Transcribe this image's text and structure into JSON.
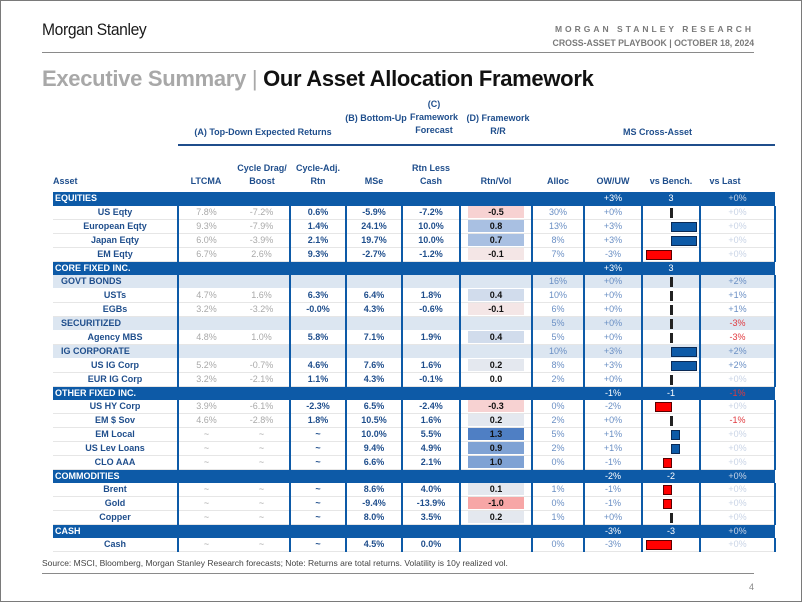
{
  "header": {
    "brand": "Morgan Stanley",
    "research_label": "MORGAN STANLEY RESEARCH",
    "report_line": "CROSS-ASSET PLAYBOOK | OCTOBER 18, 2024"
  },
  "title": {
    "prefix": "Executive Summary",
    "separator": "|",
    "main": "Our Asset Allocation Framework"
  },
  "groups": {
    "a": "(A) Top-Down Expected Returns",
    "b": "(B) Bottom-Up",
    "c": "(C) Framework Forecast",
    "d": "(D) Framework R/R",
    "ms": "MS Cross-Asset"
  },
  "columns": [
    "Asset",
    "LTCMA",
    "Cycle Drag/ Boost",
    "Cycle-Adj. Rtn",
    "MSe",
    "Rtn Less Cash",
    "Rtn/Vol",
    "Alloc",
    "OW/UW",
    "vs Bench.",
    "vs Last"
  ],
  "colors": {
    "section_bg": "#0d5aa7",
    "positive_bar": "#0d5aa7",
    "negative_bar": "#ff0000",
    "header_text": "#1f4e8c",
    "negative_text": "#e0393e"
  },
  "rows": [
    {
      "type": "section",
      "name": "EQUITIES",
      "owuw": "+3%",
      "bench": "3",
      "vslast": "+0%",
      "vslast_tone": "mute"
    },
    {
      "type": "asset",
      "name": "US Eqty",
      "ltcma": "7.8%",
      "cycle": "-7.2%",
      "adj": "0.6%",
      "mse": "-5.9%",
      "rlc": "-7.2%",
      "rv": "-0.5",
      "alloc": "30%",
      "owuw": "+0%",
      "bench": 0,
      "vslast": "+0%",
      "vslast_tone": "mute"
    },
    {
      "type": "asset",
      "name": "European Eqty",
      "ltcma": "9.3%",
      "cycle": "-7.9%",
      "adj": "1.4%",
      "mse": "24.1%",
      "rlc": "10.0%",
      "rv": "0.8",
      "alloc": "13%",
      "owuw": "+3%",
      "bench": 3,
      "vslast": "+0%",
      "vslast_tone": "mute"
    },
    {
      "type": "asset",
      "name": "Japan Eqty",
      "ltcma": "6.0%",
      "cycle": "-3.9%",
      "adj": "2.1%",
      "mse": "19.7%",
      "rlc": "10.0%",
      "rv": "0.7",
      "alloc": "8%",
      "owuw": "+3%",
      "bench": 3,
      "vslast": "+0%",
      "vslast_tone": "mute"
    },
    {
      "type": "asset",
      "name": "EM Eqty",
      "ltcma": "6.7%",
      "cycle": "2.6%",
      "adj": "9.3%",
      "mse": "-2.7%",
      "rlc": "-1.2%",
      "rv": "-0.1",
      "alloc": "7%",
      "owuw": "-3%",
      "bench": -3,
      "vslast": "+0%",
      "vslast_tone": "mute"
    },
    {
      "type": "section",
      "name": "CORE FIXED INC.",
      "owuw": "+3%",
      "bench": "3",
      "vslast": "",
      "vslast_tone": "mute"
    },
    {
      "type": "sub",
      "name": "GOVT BONDS",
      "alloc": "16%",
      "owuw": "+0%",
      "bench": 0,
      "vslast": "+2%",
      "vslast_tone": "pos"
    },
    {
      "type": "asset",
      "name": "USTs",
      "ltcma": "4.7%",
      "cycle": "1.6%",
      "adj": "6.3%",
      "mse": "6.4%",
      "rlc": "1.8%",
      "rv": "0.4",
      "alloc": "10%",
      "owuw": "+0%",
      "bench": 0,
      "vslast": "+1%",
      "vslast_tone": "pos"
    },
    {
      "type": "asset",
      "name": "EGBs",
      "ltcma": "3.2%",
      "cycle": "-3.2%",
      "adj": "-0.0%",
      "mse": "4.3%",
      "rlc": "-0.6%",
      "rv": "-0.1",
      "alloc": "6%",
      "owuw": "+0%",
      "bench": 0,
      "vslast": "+1%",
      "vslast_tone": "pos"
    },
    {
      "type": "sub",
      "name": "SECURITIZED",
      "alloc": "5%",
      "owuw": "+0%",
      "bench": 0,
      "vslast": "-3%",
      "vslast_tone": "neg"
    },
    {
      "type": "asset",
      "name": "Agency MBS",
      "ltcma": "4.8%",
      "cycle": "1.0%",
      "adj": "5.8%",
      "mse": "7.1%",
      "rlc": "1.9%",
      "rv": "0.4",
      "alloc": "5%",
      "owuw": "+0%",
      "bench": 0,
      "vslast": "-3%",
      "vslast_tone": "neg"
    },
    {
      "type": "sub",
      "name": "IG CORPORATE",
      "alloc": "10%",
      "owuw": "+3%",
      "bench": 3,
      "vslast": "+2%",
      "vslast_tone": "pos"
    },
    {
      "type": "asset",
      "name": "US IG Corp",
      "ltcma": "5.2%",
      "cycle": "-0.7%",
      "adj": "4.6%",
      "mse": "7.6%",
      "rlc": "1.6%",
      "rv": "0.2",
      "alloc": "8%",
      "owuw": "+3%",
      "bench": 3,
      "vslast": "+2%",
      "vslast_tone": "pos"
    },
    {
      "type": "asset",
      "name": "EUR IG Corp",
      "ltcma": "3.2%",
      "cycle": "-2.1%",
      "adj": "1.1%",
      "mse": "4.3%",
      "rlc": "-0.1%",
      "rv": "0.0",
      "alloc": "2%",
      "owuw": "+0%",
      "bench": 0,
      "vslast": "+0%",
      "vslast_tone": "mute"
    },
    {
      "type": "section",
      "name": "OTHER FIXED INC.",
      "owuw": "-1%",
      "bench": "-1",
      "vslast": "-1%",
      "vslast_tone": "neg"
    },
    {
      "type": "asset",
      "name": "US HY Corp",
      "ltcma": "3.9%",
      "cycle": "-6.1%",
      "adj": "-2.3%",
      "mse": "6.5%",
      "rlc": "-2.4%",
      "rv": "-0.3",
      "alloc": "0%",
      "owuw": "-2%",
      "bench": -2,
      "vslast": "+0%",
      "vslast_tone": "mute"
    },
    {
      "type": "asset",
      "name": "EM $ Sov",
      "ltcma": "4.6%",
      "cycle": "-2.8%",
      "adj": "1.8%",
      "mse": "10.5%",
      "rlc": "1.6%",
      "rv": "0.2",
      "alloc": "2%",
      "owuw": "+0%",
      "bench": 0,
      "vslast": "-1%",
      "vslast_tone": "neg"
    },
    {
      "type": "asset",
      "name": "EM Local",
      "ltcma": "~",
      "cycle": "~",
      "adj": "~",
      "mse": "10.0%",
      "rlc": "5.5%",
      "rv": "1.3",
      "alloc": "5%",
      "owuw": "+1%",
      "bench": 1,
      "vslast": "+0%",
      "vslast_tone": "mute"
    },
    {
      "type": "asset",
      "name": "US Lev Loans",
      "ltcma": "~",
      "cycle": "~",
      "adj": "~",
      "mse": "9.4%",
      "rlc": "4.9%",
      "rv": "0.9",
      "alloc": "2%",
      "owuw": "+1%",
      "bench": 1,
      "vslast": "+0%",
      "vslast_tone": "mute"
    },
    {
      "type": "asset",
      "name": "CLO AAA",
      "ltcma": "~",
      "cycle": "~",
      "adj": "~",
      "mse": "6.6%",
      "rlc": "2.1%",
      "rv": "1.0",
      "alloc": "0%",
      "owuw": "-1%",
      "bench": -1,
      "vslast": "+0%",
      "vslast_tone": "mute"
    },
    {
      "type": "section",
      "name": "COMMODITIES",
      "owuw": "-2%",
      "bench": "-2",
      "vslast": "+0%",
      "vslast_tone": "mute"
    },
    {
      "type": "asset",
      "name": "Brent",
      "ltcma": "~",
      "cycle": "~",
      "adj": "~",
      "mse": "8.6%",
      "rlc": "4.0%",
      "rv": "0.1",
      "alloc": "1%",
      "owuw": "-1%",
      "bench": -1,
      "vslast": "+0%",
      "vslast_tone": "mute"
    },
    {
      "type": "asset",
      "name": "Gold",
      "ltcma": "~",
      "cycle": "~",
      "adj": "~",
      "mse": "-9.4%",
      "rlc": "-13.9%",
      "rv": "-1.0",
      "alloc": "0%",
      "owuw": "-1%",
      "bench": -1,
      "vslast": "+0%",
      "vslast_tone": "mute"
    },
    {
      "type": "asset",
      "name": "Copper",
      "ltcma": "~",
      "cycle": "~",
      "adj": "~",
      "mse": "8.0%",
      "rlc": "3.5%",
      "rv": "0.2",
      "alloc": "1%",
      "owuw": "+0%",
      "bench": 0,
      "vslast": "+0%",
      "vslast_tone": "mute"
    },
    {
      "type": "section",
      "name": "CASH",
      "owuw": "-3%",
      "bench": "-3",
      "vslast": "+0%",
      "vslast_tone": "mute"
    },
    {
      "type": "asset",
      "name": "Cash",
      "ltcma": "~",
      "cycle": "~",
      "adj": "~",
      "mse": "4.5%",
      "rlc": "0.0%",
      "rv": "",
      "alloc": "0%",
      "owuw": "-3%",
      "bench": -3,
      "vslast": "+0%",
      "vslast_tone": "mute"
    }
  ],
  "footer": {
    "source": "Source: MSCI, Bloomberg, Morgan Stanley Research forecasts; Note: Returns are total returns. Volatility is 10y realized vol.",
    "page": "4"
  }
}
